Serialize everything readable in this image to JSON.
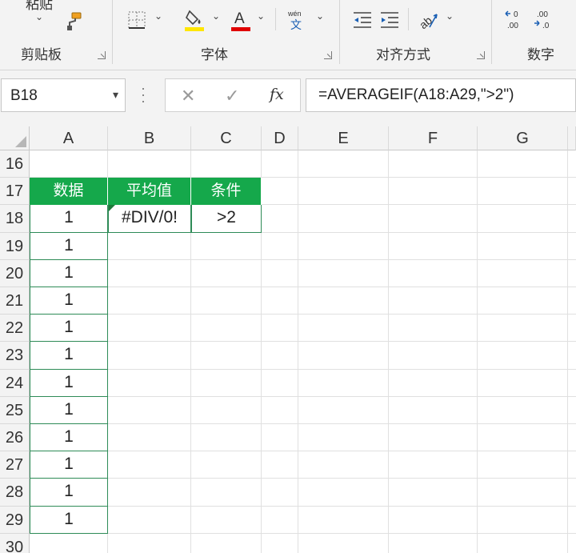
{
  "ribbon": {
    "groups": {
      "clipboard": {
        "label": "剪贴板",
        "paste_label": "粘贴"
      },
      "font": {
        "label": "字体"
      },
      "alignment": {
        "label": "对齐方式"
      },
      "number": {
        "label": "数字"
      }
    },
    "colors": {
      "highlight": "#ffe600",
      "font_color": "#e00000"
    },
    "icons": [
      "chevron-down-icon",
      "format-painter-icon",
      "border-icon",
      "fill-color-icon",
      "font-color-icon",
      "phonetic-guide-icon",
      "decrease-indent-icon",
      "increase-indent-icon",
      "orientation-icon",
      "decrease-decimal-icon",
      "increase-decimal-icon",
      "dialog-launcher-icon"
    ]
  },
  "formula_bar": {
    "name_box": "B18",
    "formula": "=AVERAGEIF(A18:A29,\">2\")",
    "icons": [
      "cancel-icon",
      "enter-icon",
      "insert-function-icon"
    ]
  },
  "grid": {
    "columns": [
      "A",
      "B",
      "C",
      "D",
      "E",
      "F",
      "G"
    ],
    "rows": [
      "16",
      "17",
      "18",
      "19",
      "20",
      "21",
      "22",
      "23",
      "24",
      "25",
      "26",
      "27",
      "28",
      "29",
      "30"
    ],
    "header_color": "#15a84b",
    "table_headers": [
      "数据",
      "平均值",
      "条件"
    ],
    "data_values": [
      "1",
      "1",
      "1",
      "1",
      "1",
      "1",
      "1",
      "1",
      "1",
      "1",
      "1",
      "1"
    ],
    "result": "#DIV/0!",
    "condition": ">2"
  }
}
